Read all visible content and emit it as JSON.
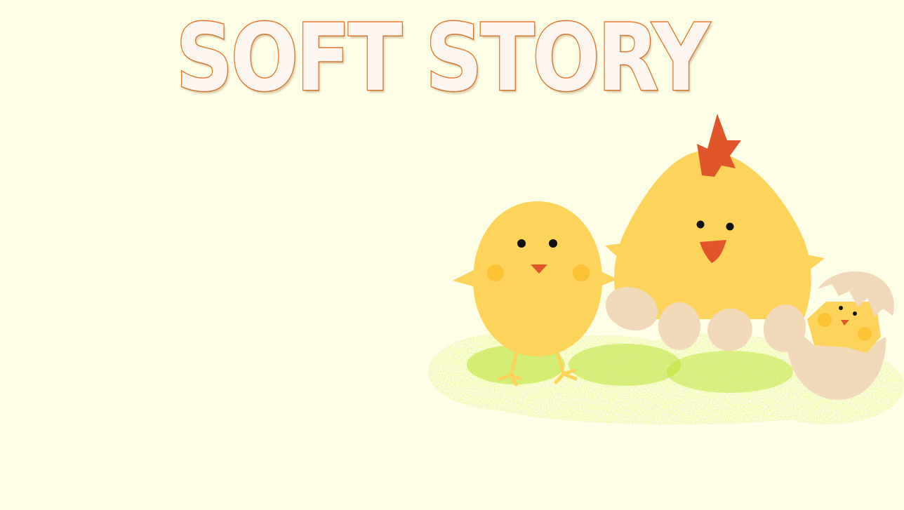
{
  "title": "SOFT STORY",
  "colors": {
    "background": "#fefee6",
    "title_fill": "#fdf5ef",
    "title_outline": "#e8782e",
    "chick_yellow": "#fdd35a",
    "cheek_yellow": "#fbc234",
    "beak_comb_orange": "#e0562a",
    "egg_shell": "#f2d9ba",
    "grass_green": "#b8e22b"
  },
  "scene": {
    "characters": [
      "small-chick",
      "hen",
      "hatching-chick"
    ],
    "props": [
      "eggs",
      "grass-nest",
      "cracked-eggshell"
    ]
  }
}
